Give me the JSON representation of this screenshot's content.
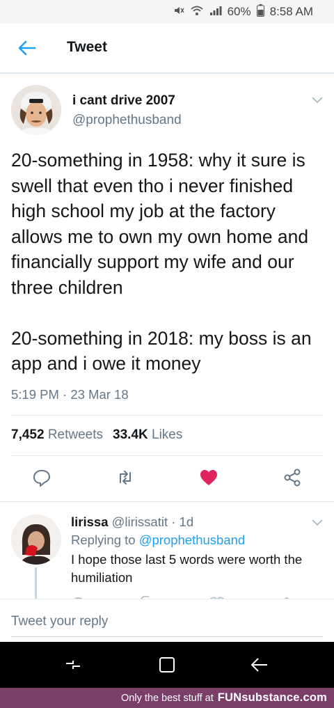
{
  "status_bar": {
    "battery": "60%",
    "time": "8:58 AM",
    "icons": [
      "mute-icon",
      "wifi-icon",
      "signal-icon",
      "battery-icon"
    ]
  },
  "header": {
    "title": "Tweet",
    "back_icon": "arrow-left-icon"
  },
  "tweet": {
    "author_name": "i cant drive 2007",
    "author_handle": "@prophethusband",
    "text": "20-something in 1958: why it sure is swell that even tho i never finished high school my job at the factory allows me to own my own home and financially support my wife and our three children\n\n20-something in 2018: my boss is an app and i owe it money",
    "timestamp": "5:19 PM · 23 Mar 18",
    "retweets_count": "7,452",
    "retweets_label": "Retweets",
    "likes_count": "33.4K",
    "likes_label": "Likes",
    "liked": true,
    "accent_color": "#1da1f2",
    "like_color": "#e0245e"
  },
  "reply": {
    "author_name": "lirissa",
    "author_handle": "@lirissatit",
    "age": "· 1d",
    "replying_prefix": "Replying to",
    "replying_to": "@prophethusband",
    "text": "I hope those last 5 words were worth the humiliation"
  },
  "composer": {
    "placeholder": "Tweet your reply"
  },
  "footer": {
    "tagline": "Only the best stuff at",
    "brand": "FUNsubstance.com"
  }
}
